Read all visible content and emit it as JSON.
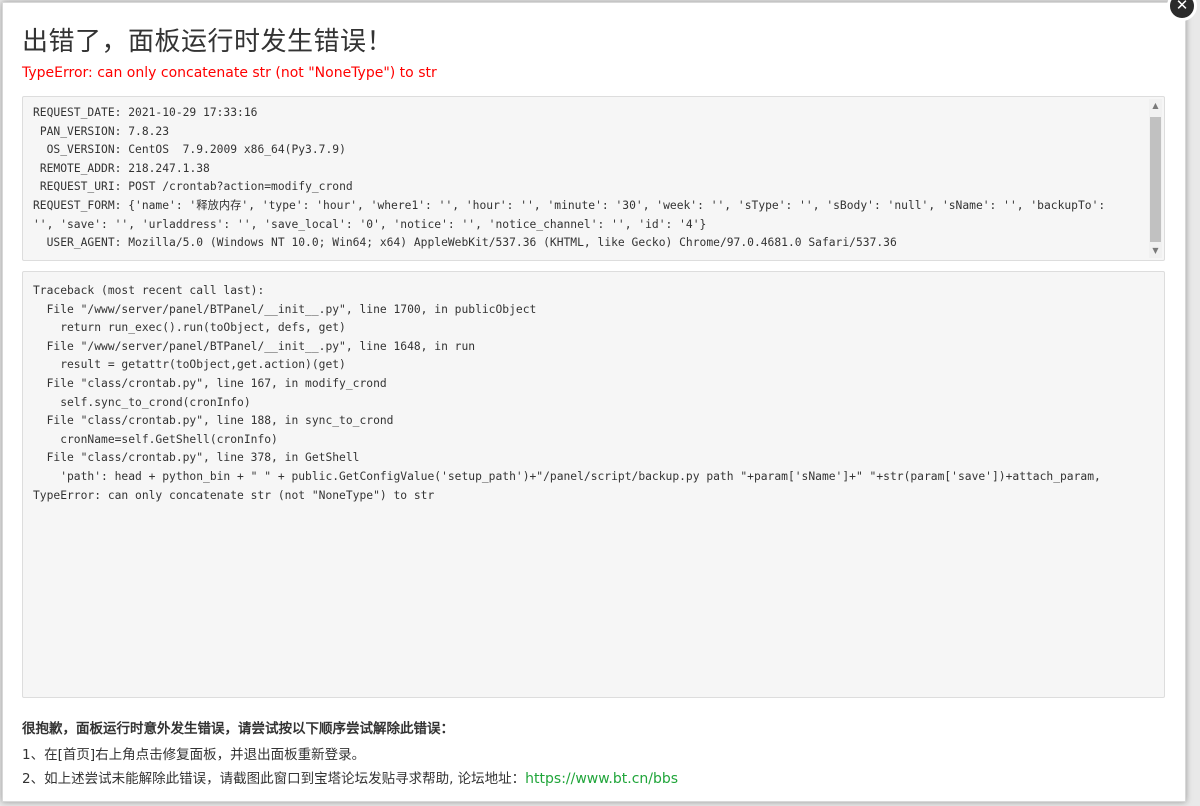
{
  "title": "出错了，面板运行时发生错误！",
  "error_message": "TypeError: can only concatenate str (not \"NoneType\") to str",
  "request_info": "REQUEST_DATE: 2021-10-29 17:33:16\n PAN_VERSION: 7.8.23\n  OS_VERSION: CentOS  7.9.2009 x86_64(Py3.7.9)\n REMOTE_ADDR: 218.247.1.38\n REQUEST_URI: POST /crontab?action=modify_crond\nREQUEST_FORM: {'name': '释放内存', 'type': 'hour', 'where1': '', 'hour': '', 'minute': '30', 'week': '', 'sType': '', 'sBody': 'null', 'sName': '', 'backupTo': '', 'save': '', 'urladdress': '', 'save_local': '0', 'notice': '', 'notice_channel': '', 'id': '4'}\n  USER_AGENT: Mozilla/5.0 (Windows NT 10.0; Win64; x64) AppleWebKit/537.36 (KHTML, like Gecko) Chrome/97.0.4681.0 Safari/537.36",
  "traceback": "Traceback (most recent call last):\n  File \"/www/server/panel/BTPanel/__init__.py\", line 1700, in publicObject\n    return run_exec().run(toObject, defs, get)\n  File \"/www/server/panel/BTPanel/__init__.py\", line 1648, in run\n    result = getattr(toObject,get.action)(get)\n  File \"class/crontab.py\", line 167, in modify_crond\n    self.sync_to_crond(cronInfo)\n  File \"class/crontab.py\", line 188, in sync_to_crond\n    cronName=self.GetShell(cronInfo)\n  File \"class/crontab.py\", line 378, in GetShell\n    'path': head + python_bin + \" \" + public.GetConfigValue('setup_path')+\"/panel/script/backup.py path \"+param['sName']+\" \"+str(param['save'])+attach_param,\nTypeError: can only concatenate str (not \"NoneType\") to str",
  "help": {
    "heading": "很抱歉，面板运行时意外发生错误，请尝试按以下顺序尝试解除此错误：",
    "step1": "1、在[首页]右上角点击修复面板，并退出面板重新登录。",
    "step2": "2、如上述尝试未能解除此错误，请截图此窗口到宝塔论坛发贴寻求帮助, 论坛地址：",
    "forum_link": "https://www.bt.cn/bbs"
  },
  "colors": {
    "error": "#ff0000",
    "link": "#20a53a"
  },
  "icons": {
    "close": "close-icon",
    "scroll_up": "scroll-up-arrow-icon",
    "scroll_down": "scroll-down-arrow-icon"
  }
}
